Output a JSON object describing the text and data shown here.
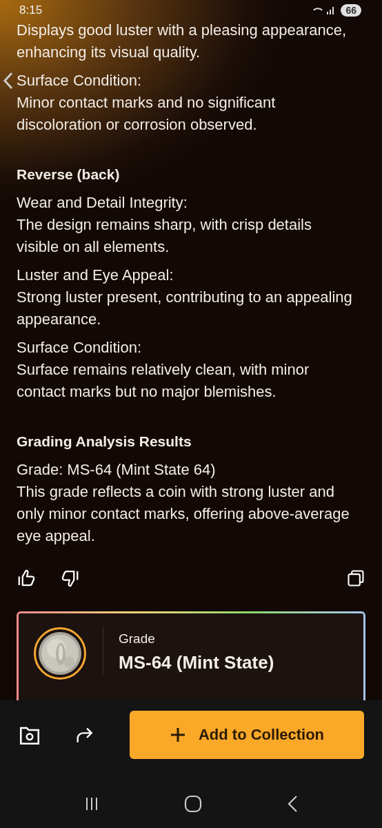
{
  "status_bar": {
    "time": "8:15",
    "battery": "66"
  },
  "blocks": [
    {
      "kind": "item",
      "text": "Displays good luster with a pleasing appearance, enhancing its visual quality."
    },
    {
      "kind": "item",
      "label": "Surface Condition:",
      "text": "Minor contact marks and no significant discoloration or corrosion observed."
    },
    {
      "kind": "heading",
      "text": "Reverse (back)"
    },
    {
      "kind": "item",
      "label": "Wear and Detail Integrity:",
      "text": "The design remains sharp, with crisp details visible on all elements."
    },
    {
      "kind": "item",
      "label": "Luster and Eye Appeal:",
      "text": "Strong luster present, contributing to an appealing appearance."
    },
    {
      "kind": "item",
      "label": "Surface Condition:",
      "text": "Surface remains relatively clean, with minor contact marks but no major blemishes."
    },
    {
      "kind": "heading",
      "text": "Grading Analysis Results"
    },
    {
      "kind": "item",
      "label": "Grade: MS-64 (Mint State 64)",
      "text": "This grade reflects a coin with strong luster and only minor contact marks, offering above-average eye appeal."
    }
  ],
  "result_card": {
    "label": "Grade",
    "value": "MS-64 (Mint State)"
  },
  "add_button": {
    "label": "Add to Collection"
  }
}
